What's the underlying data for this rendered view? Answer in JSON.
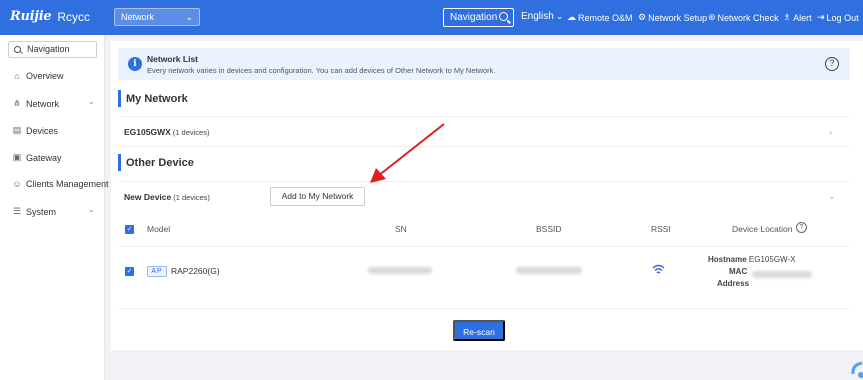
{
  "header": {
    "logo_brand": "Ruijie",
    "logo_sub": "Rcycc",
    "network_select": "Network",
    "navigation": "Navigation",
    "language": "English",
    "remote": "Remote O&M",
    "setup": "Network Setup",
    "check": "Network Check",
    "alert": "Alert",
    "logout": "Log Out"
  },
  "sidebar": {
    "search": "Navigation",
    "items": [
      {
        "label": "Overview",
        "icon": "home-icon"
      },
      {
        "label": "Network",
        "icon": "network-icon"
      },
      {
        "label": "Devices",
        "icon": "devices-icon"
      },
      {
        "label": "Gateway",
        "icon": "gateway-icon"
      },
      {
        "label": "Clients Management",
        "icon": "clients-icon"
      },
      {
        "label": "System",
        "icon": "system-icon"
      }
    ]
  },
  "banner": {
    "title": "Network List",
    "text": "Every network varies in devices and configuration. You can add devices of Other Network to My Network."
  },
  "my_network": {
    "title": "My Network",
    "group": "EG105GWX",
    "count": "(1 devices)"
  },
  "other_device": {
    "title": "Other Device",
    "group": "New Device",
    "count": "(1 devices)",
    "add_button": "Add to My Network",
    "columns": [
      "Model",
      "SN",
      "BSSID",
      "RSSI",
      "Device Location"
    ],
    "rows": [
      {
        "type": "AP",
        "model": "RAP2260(G)",
        "hostname_label": "Hostname",
        "hostname": "EG105GW-X",
        "mac_label": "MAC",
        "address_label": "Address"
      }
    ],
    "rescan_button": "Re-scan"
  },
  "colors": {
    "accent": "#2f6fe0",
    "annotation": "#e02020"
  }
}
